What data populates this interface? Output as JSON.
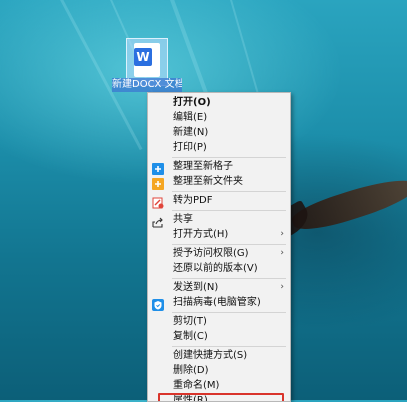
{
  "desktop": {
    "file_icon": {
      "label": "新建DOCX 文档.docx",
      "badge": "W",
      "icon": "word-document-icon"
    }
  },
  "menu": {
    "items": [
      {
        "label": "打开(O)",
        "bold": true
      },
      {
        "label": "编辑(E)"
      },
      {
        "label": "新建(N)"
      },
      {
        "label": "打印(P)"
      },
      {
        "label": "整理至新格子",
        "icon": "fences-grid-blue-icon"
      },
      {
        "label": "整理至新文件夹",
        "icon": "folder-plus-orange-icon"
      },
      {
        "label": "转为PDF",
        "icon": "pdf-convert-icon"
      },
      {
        "label": "共享",
        "icon": "share-icon"
      },
      {
        "label": "打开方式(H)",
        "submenu": true
      },
      {
        "label": "授予访问权限(G)",
        "submenu": true
      },
      {
        "label": "还原以前的版本(V)"
      },
      {
        "label": "发送到(N)",
        "submenu": true
      },
      {
        "label": "扫描病毒(电脑管家)",
        "icon": "shield-scan-icon"
      },
      {
        "label": "剪切(T)"
      },
      {
        "label": "复制(C)"
      },
      {
        "label": "创建快捷方式(S)"
      },
      {
        "label": "删除(D)"
      },
      {
        "label": "重命名(M)"
      },
      {
        "label": "属性(R)",
        "highlighted": true
      }
    ],
    "submenu_arrow": "›"
  },
  "colors": {
    "menu_bg": "#f2f2f2",
    "highlight_border": "#d9342b",
    "icon_blue": "#1f8fe8",
    "icon_orange": "#f5a623"
  }
}
